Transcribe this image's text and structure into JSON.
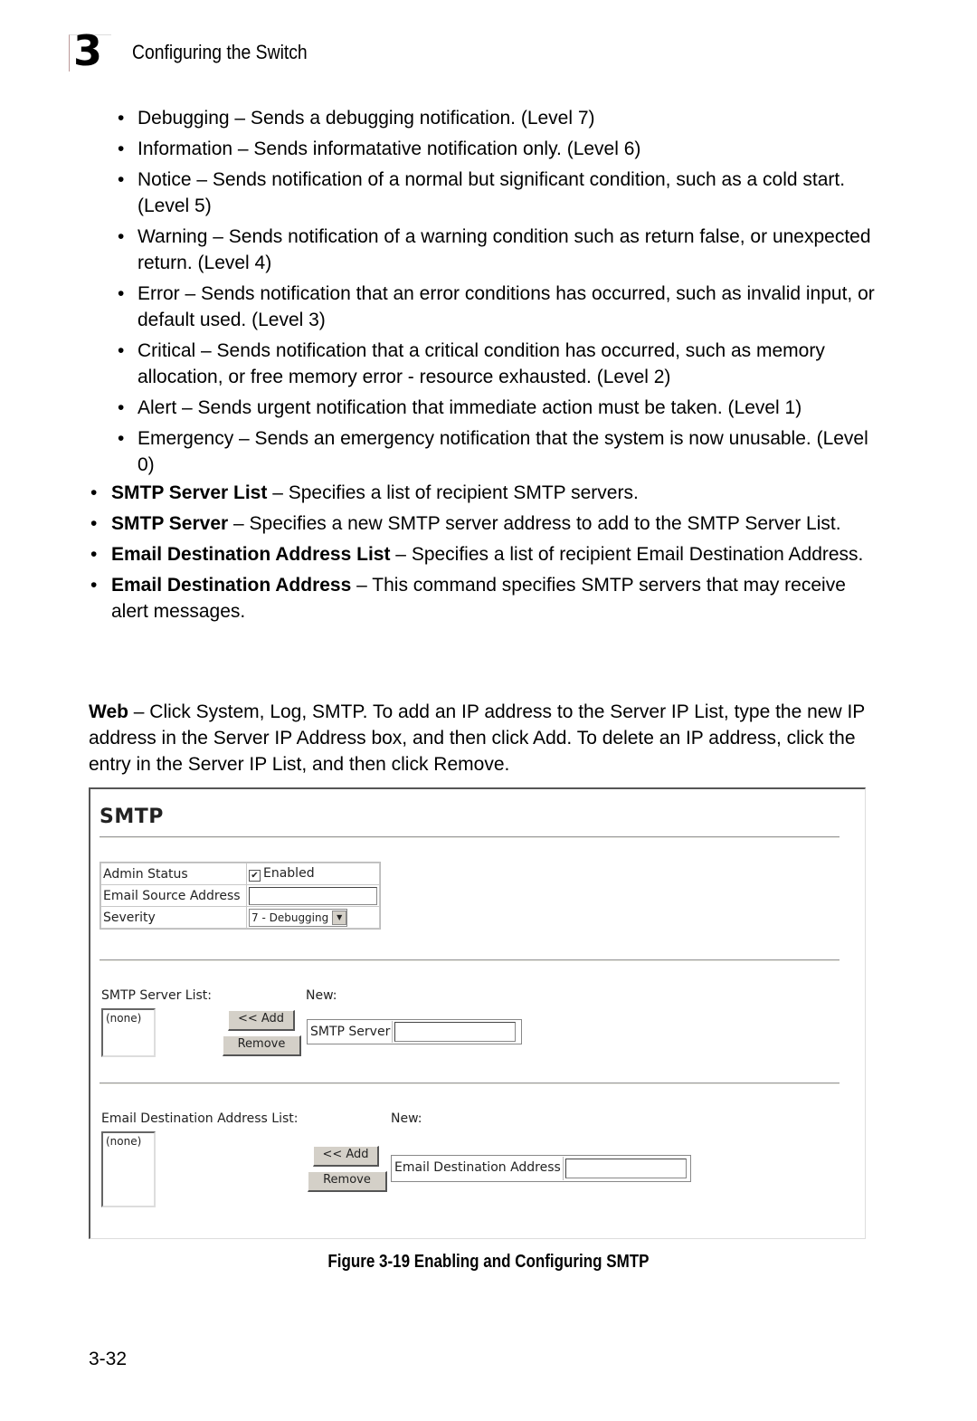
{
  "header": {
    "chapter_number": "3",
    "chapter_title": "Configuring the Switch"
  },
  "severity_levels": [
    "Debugging – Sends a debugging notification. (Level 7)",
    "Information – Sends informatative notification only. (Level 6)",
    "Notice – Sends notification of a normal but significant condition, such as a cold start. (Level 5)",
    "Warning – Sends notification of a warning condition such as return false, or unexpected return. (Level 4)",
    "Error – Sends notification that an error conditions has occurred, such as invalid input, or default used. (Level 3)",
    "Critical – Sends notification that a critical condition has occurred, such as memory allocation, or free memory error - resource exhausted. (Level 2)",
    "Alert – Sends urgent notification that immediate action must be taken. (Level 1)",
    "Emergency – Sends an emergency notification that the system is now unusable. (Level 0)"
  ],
  "fields": [
    {
      "term": "SMTP Server List",
      "desc": " – Specifies a list of recipient SMTP servers."
    },
    {
      "term": "SMTP Server",
      "desc": " – Specifies a new SMTP server address to add to the SMTP Server List."
    },
    {
      "term": "Email Destination Address List",
      "desc": " – Specifies a list of recipient Email Destination Address."
    },
    {
      "term": "Email Destination Address",
      "desc": " – This command specifies SMTP servers that may receive alert messages."
    }
  ],
  "web": {
    "term": "Web",
    "text": " – Click System, Log, SMTP. To add an IP address to the Server IP List, type the new IP address in the Server IP Address box, and then click Add. To delete an IP address, click the entry in the Server IP List, and then click Remove."
  },
  "screenshot": {
    "title": "SMTP",
    "admin_status_label": "Admin Status",
    "admin_status_checked": true,
    "admin_status_value": "Enabled",
    "email_source_label": "Email Source Address",
    "email_source_value": "",
    "severity_label": "Severity",
    "severity_value": "7 - Debugging",
    "server_list_label": "SMTP Server List:",
    "server_list_items": [
      "(none)"
    ],
    "server_new_label": "New:",
    "server_add_label": "<< Add",
    "server_remove_label": "Remove",
    "server_field_label": "SMTP Server",
    "server_field_value": "",
    "dest_list_label": "Email Destination Address List:",
    "dest_list_items": [
      "(none)"
    ],
    "dest_new_label": "New:",
    "dest_add_label": "<< Add",
    "dest_remove_label": "Remove",
    "dest_field_label": "Email Destination Address",
    "dest_field_value": ""
  },
  "caption": "Figure 3-19  Enabling and Configuring SMTP",
  "page_number": "3-32"
}
